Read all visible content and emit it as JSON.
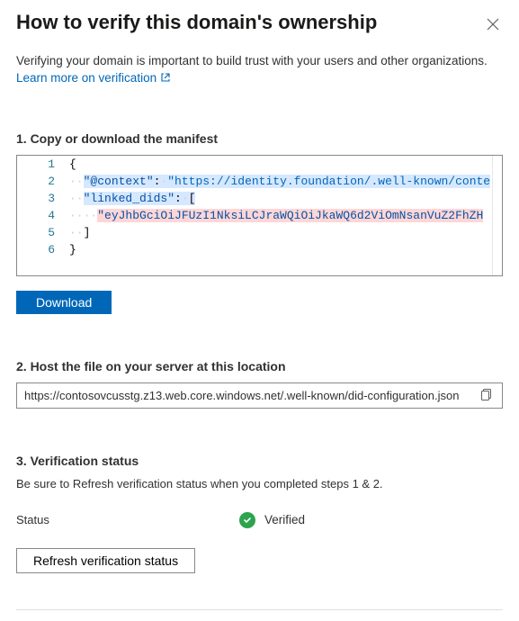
{
  "header": {
    "title": "How to verify this domain's ownership"
  },
  "intro": {
    "text": "Verifying your domain is important to build trust with your users and other organizations.",
    "link_text": "Learn more on verification"
  },
  "step1": {
    "title": "1. Copy or download the manifest",
    "download_label": "Download",
    "manifest": {
      "context_key": "\"@context\"",
      "context_val": "\"https://identity.foundation/.well-known/conte",
      "linked_key": "\"linked_dids\"",
      "jwt": "\"eyJhbGciOiJFUzI1NksiLCJraWQiOiJkaWQ6d2ViOmNsanVuZ2FhZH"
    }
  },
  "step2": {
    "title": "2. Host the file on your server at this location",
    "url": "https://contosovcusstg.z13.web.core.windows.net/.well-known/did-configuration.json"
  },
  "step3": {
    "title": "3. Verification status",
    "note": "Be sure to Refresh verification status when you completed steps 1 & 2.",
    "status_label": "Status",
    "status_value": "Verified",
    "refresh_label": "Refresh verification status"
  }
}
